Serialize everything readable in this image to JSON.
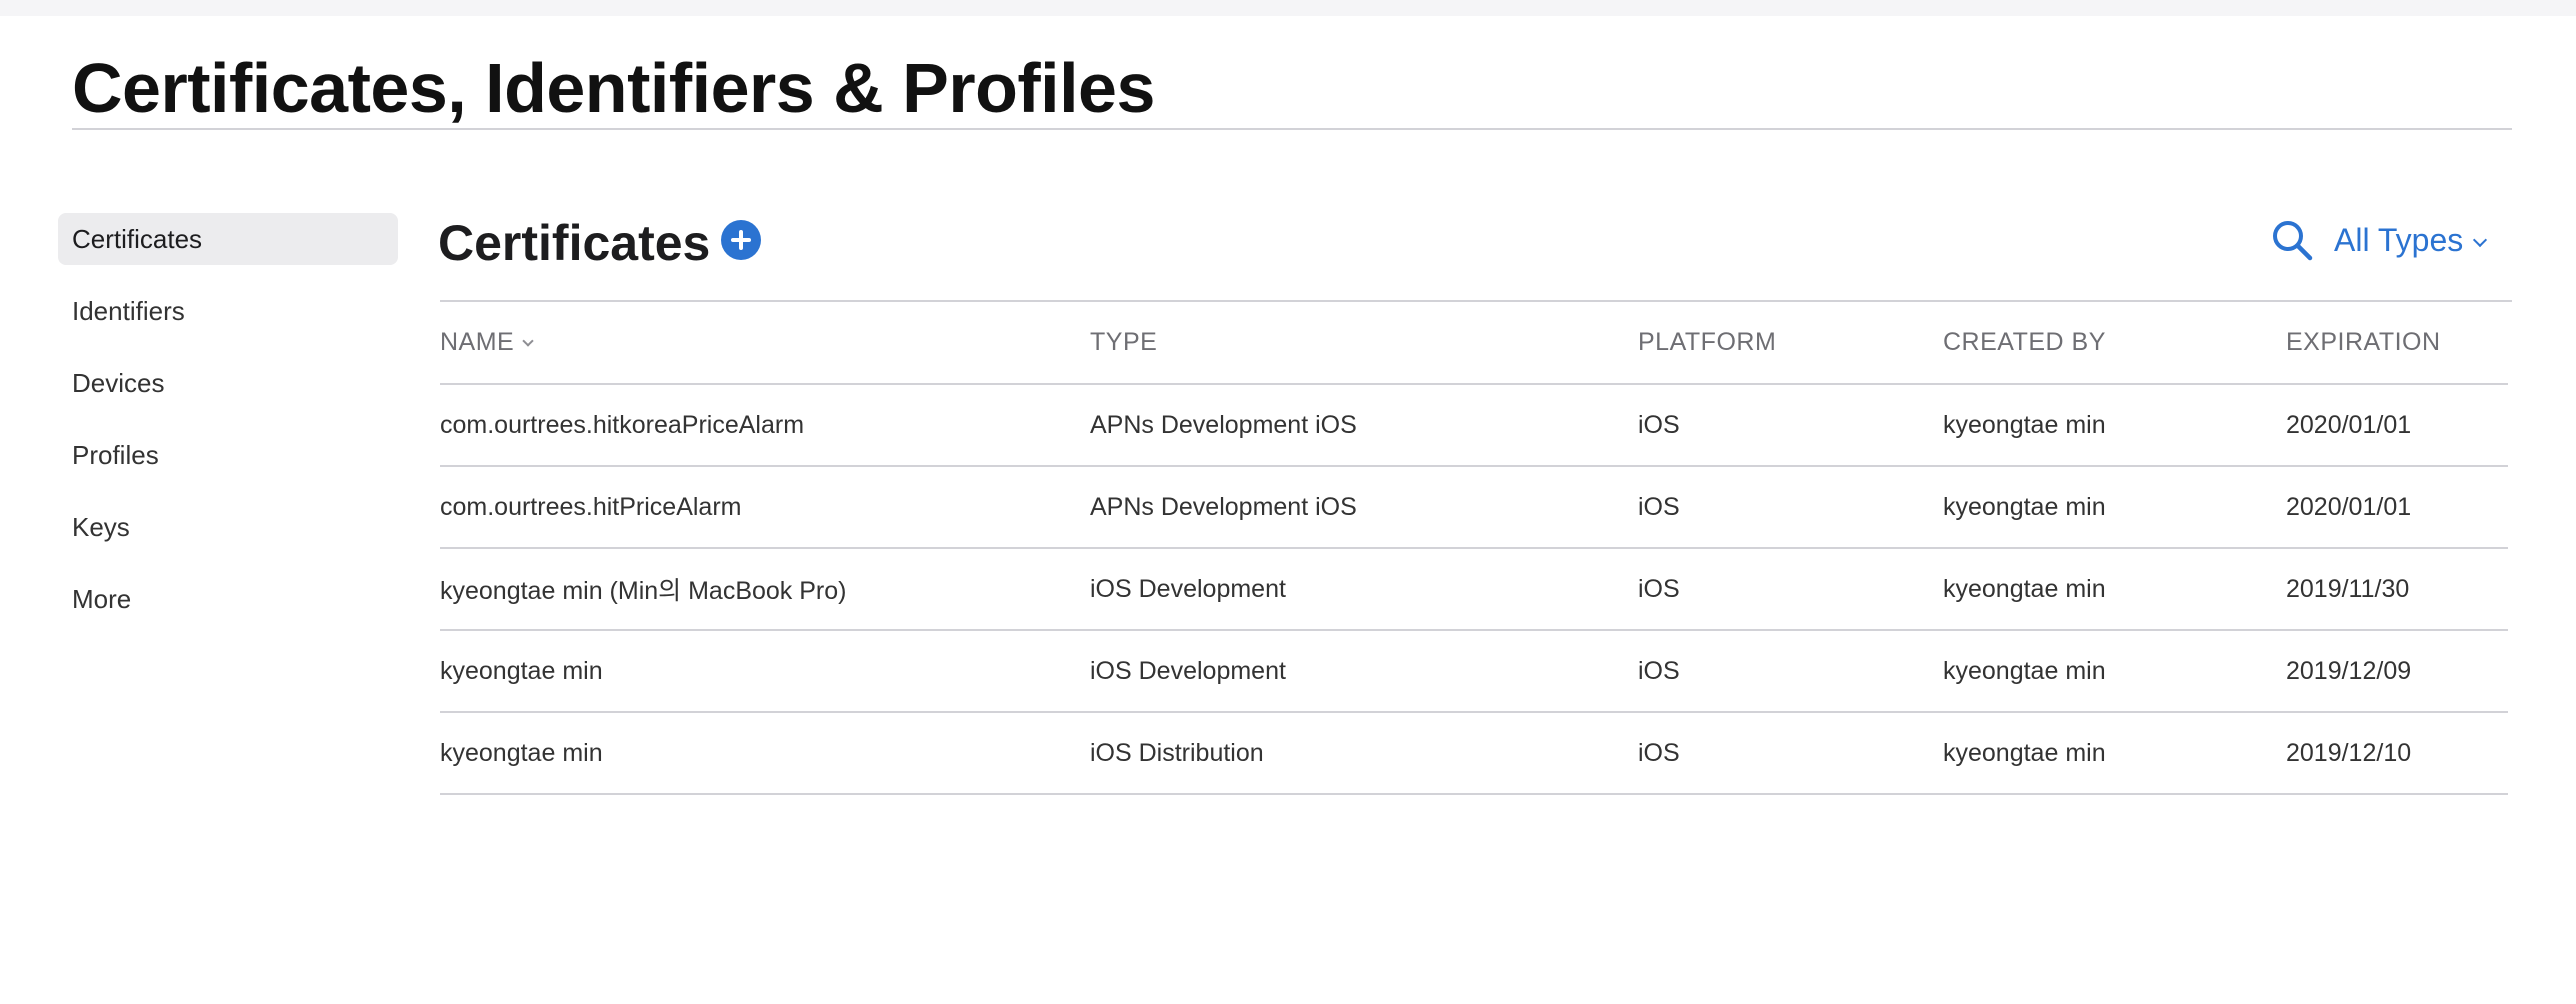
{
  "page": {
    "title": "Certificates, Identifiers & Profiles"
  },
  "sidebar": {
    "items": [
      {
        "label": "Certificates",
        "active": true
      },
      {
        "label": "Identifiers"
      },
      {
        "label": "Devices"
      },
      {
        "label": "Profiles"
      },
      {
        "label": "Keys"
      },
      {
        "label": "More"
      }
    ]
  },
  "main": {
    "section_title": "Certificates",
    "add_icon": "plus-circle-icon",
    "search_icon": "search-icon",
    "filter_label": "All Types",
    "accent_color": "#2b73d1"
  },
  "table": {
    "headers": [
      "NAME",
      "TYPE",
      "PLATFORM",
      "CREATED BY",
      "EXPIRATION"
    ],
    "rows": [
      [
        "com.ourtrees.hitkoreaPriceAlarm",
        "APNs Development iOS",
        "iOS",
        "kyeongtae min",
        "2020/01/01"
      ],
      [
        "com.ourtrees.hitPriceAlarm",
        "APNs Development iOS",
        "iOS",
        "kyeongtae min",
        "2020/01/01"
      ],
      [
        "kyeongtae min (Min의 MacBook Pro)",
        "iOS Development",
        "iOS",
        "kyeongtae min",
        "2019/11/30"
      ],
      [
        "kyeongtae min",
        "iOS Development",
        "iOS",
        "kyeongtae min",
        "2019/12/09"
      ],
      [
        "kyeongtae min",
        "iOS Distribution",
        "iOS",
        "kyeongtae min",
        "2019/12/10"
      ]
    ]
  }
}
